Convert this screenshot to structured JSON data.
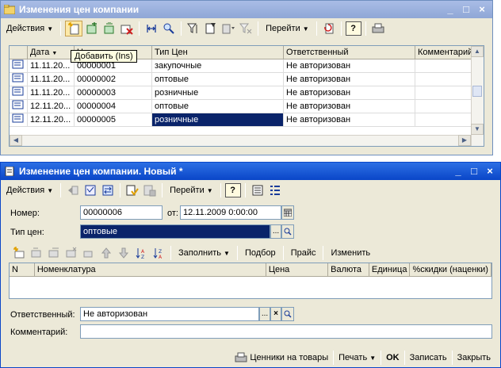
{
  "list_window": {
    "title": "Изменения цен компании",
    "toolbar": {
      "actions_label": "Действия",
      "goto_label": "Перейти",
      "help_label": "?"
    },
    "tooltip": "Добавить (Ins)",
    "columns": [
      "Дата",
      "Номер",
      "Тип Цен",
      "Ответственный",
      "Комментарий"
    ],
    "rows": [
      {
        "date": "11.11.20...",
        "number": "00000001",
        "price_type": "закупочные",
        "responsible": "Не авторизован",
        "comment": ""
      },
      {
        "date": "11.11.20...",
        "number": "00000002",
        "price_type": "оптовые",
        "responsible": "Не авторизован",
        "comment": ""
      },
      {
        "date": "11.11.20...",
        "number": "00000003",
        "price_type": "розничные",
        "responsible": "Не авторизован",
        "comment": ""
      },
      {
        "date": "12.11.20...",
        "number": "00000004",
        "price_type": "оптовые",
        "responsible": "Не авторизован",
        "comment": ""
      },
      {
        "date": "12.11.20...",
        "number": "00000005",
        "price_type": "розничные",
        "responsible": "Не авторизован",
        "comment": ""
      }
    ]
  },
  "doc_window": {
    "title": "Изменение цен компании. Новый *",
    "toolbar": {
      "actions_label": "Действия",
      "goto_label": "Перейти",
      "help_label": "?"
    },
    "number_label": "Номер:",
    "number_value": "00000006",
    "from_label": "от:",
    "date_value": "12.11.2009  0:00:00",
    "price_type_label": "Тип цен:",
    "price_type_value": "оптовые",
    "tab_toolbar": {
      "fill_label": "Заполнить",
      "select_label": "Подбор",
      "price_label": "Прайс",
      "change_label": "Изменить"
    },
    "table_columns": [
      "N",
      "Номенклатура",
      "Цена",
      "Валюта",
      "Единица",
      "%скидки (наценки)"
    ],
    "responsible_label": "Ответственный:",
    "responsible_value": "Не авторизован",
    "comment_label": "Комментарий:",
    "comment_value": "",
    "bottom": {
      "labels_label": "Ценники на товары",
      "print_label": "Печать",
      "ok_label": "OK",
      "save_label": "Записать",
      "close_label": "Закрыть"
    }
  },
  "colors": {
    "title_active": "#0a46c8",
    "title_inactive": "#8fa7d6",
    "selection": "#0a246a",
    "panel": "#ece9d8"
  }
}
